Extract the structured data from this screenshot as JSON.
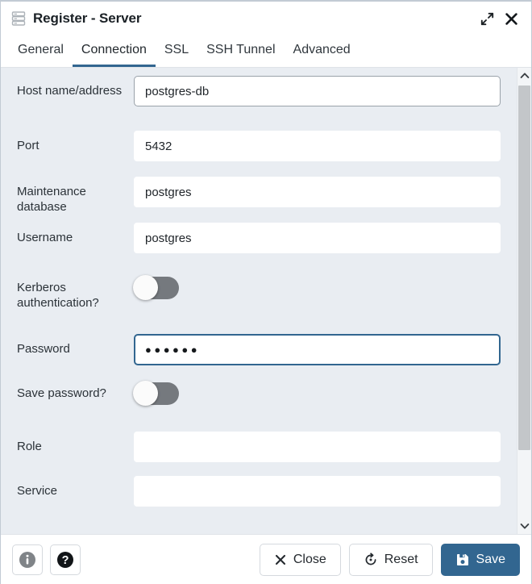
{
  "window": {
    "title": "Register - Server",
    "icon": "server-icon",
    "expand_icon": "expand-arrows-icon",
    "close_icon": "close-icon"
  },
  "tabs": [
    {
      "label": "General",
      "active": false
    },
    {
      "label": "Connection",
      "active": true
    },
    {
      "label": "SSL",
      "active": false
    },
    {
      "label": "SSH Tunnel",
      "active": false
    },
    {
      "label": "Advanced",
      "active": false
    }
  ],
  "form": {
    "host": {
      "label": "Host name/address",
      "value": "postgres-db",
      "state": "hover"
    },
    "port": {
      "label": "Port",
      "value": "5432",
      "state": "normal"
    },
    "maintdb": {
      "label": "Maintenance database",
      "value": "postgres",
      "state": "normal"
    },
    "username": {
      "label": "Username",
      "value": "postgres",
      "state": "normal"
    },
    "kerberos": {
      "label": "Kerberos authentication?",
      "value": "off"
    },
    "password": {
      "label": "Password",
      "value": "●●●●●●",
      "state": "focused"
    },
    "savepw": {
      "label": "Save password?",
      "value": "off"
    },
    "role": {
      "label": "Role",
      "value": "",
      "state": "normal"
    },
    "service": {
      "label": "Service",
      "value": "",
      "state": "normal"
    }
  },
  "scrollbar": {
    "up_icon": "chevron-up-icon",
    "down_icon": "chevron-down-icon"
  },
  "footer": {
    "info_label": "i",
    "help_label": "?",
    "close_label": "Close",
    "reset_label": "Reset",
    "save_label": "Save"
  },
  "colors": {
    "accent": "#326690",
    "form_bg": "#e9edf2",
    "toggle_off_track": "#75797e",
    "scroll_thumb": "#c3c6c9"
  }
}
